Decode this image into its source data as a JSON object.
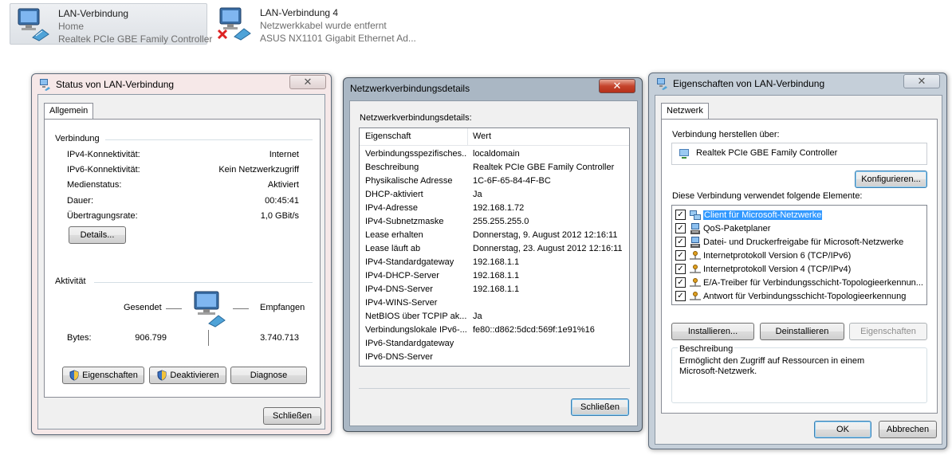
{
  "adapters": [
    {
      "name": "LAN-Verbindung",
      "status": "Home",
      "device": "Realtek PCIe GBE Family Controller",
      "selected": true
    },
    {
      "name": "LAN-Verbindung 4",
      "status": "Netzwerkkabel wurde entfernt",
      "device": "ASUS NX1101 Gigabit Ethernet Ad...",
      "selected": false
    }
  ],
  "status_window": {
    "title": "Status von LAN-Verbindung",
    "tab": "Allgemein",
    "connection_group": "Verbindung",
    "rows": [
      {
        "label": "IPv4-Konnektivität:",
        "value": "Internet"
      },
      {
        "label": "IPv6-Konnektivität:",
        "value": "Kein Netzwerkzugriff"
      },
      {
        "label": "Medienstatus:",
        "value": "Aktiviert"
      },
      {
        "label": "Dauer:",
        "value": "00:45:41"
      },
      {
        "label": "Übertragungsrate:",
        "value": "1,0 GBit/s"
      }
    ],
    "details_button": "Details...",
    "activity_group": "Aktivität",
    "sent_label": "Gesendet",
    "received_label": "Empfangen",
    "bytes_label": "Bytes:",
    "bytes_sent": "906.799",
    "bytes_received": "3.740.713",
    "properties_button": "Eigenschaften",
    "disable_button": "Deaktivieren",
    "diagnose_button": "Diagnose",
    "close_button": "Schließen"
  },
  "details_window": {
    "title": "Netzwerkverbindungsdetails",
    "heading": "Netzwerkverbindungsdetails:",
    "col_property": "Eigenschaft",
    "col_value": "Wert",
    "rows": [
      {
        "property": "Verbindungsspezifisches...",
        "value": "localdomain"
      },
      {
        "property": "Beschreibung",
        "value": "Realtek PCIe GBE Family Controller"
      },
      {
        "property": "Physikalische Adresse",
        "value": "1C-6F-65-84-4F-BC"
      },
      {
        "property": "DHCP-aktiviert",
        "value": "Ja"
      },
      {
        "property": "IPv4-Adresse",
        "value": "192.168.1.72"
      },
      {
        "property": "IPv4-Subnetzmaske",
        "value": "255.255.255.0"
      },
      {
        "property": "Lease erhalten",
        "value": "Donnerstag, 9. August 2012 12:16:11"
      },
      {
        "property": "Lease läuft ab",
        "value": "Donnerstag, 23. August 2012 12:16:11"
      },
      {
        "property": "IPv4-Standardgateway",
        "value": "192.168.1.1"
      },
      {
        "property": "IPv4-DHCP-Server",
        "value": "192.168.1.1"
      },
      {
        "property": "IPv4-DNS-Server",
        "value": "192.168.1.1"
      },
      {
        "property": "IPv4-WINS-Server",
        "value": ""
      },
      {
        "property": "NetBIOS über TCPIP ak...",
        "value": "Ja"
      },
      {
        "property": "Verbindungslokale IPv6-...",
        "value": "fe80::d862:5dcd:569f:1e91%16"
      },
      {
        "property": "IPv6-Standardgateway",
        "value": ""
      },
      {
        "property": "IPv6-DNS-Server",
        "value": ""
      }
    ],
    "close_button": "Schließen"
  },
  "props_window": {
    "title": "Eigenschaften von LAN-Verbindung",
    "tab": "Netzwerk",
    "connect_using_label": "Verbindung herstellen über:",
    "adapter_name": "Realtek PCIe GBE Family Controller",
    "configure_button": "Konfigurieren...",
    "items_label": "Diese Verbindung verwendet folgende Elemente:",
    "items": [
      {
        "label": "Client für Microsoft-Netzwerke",
        "checked": true,
        "selected": true,
        "icon": "network-client-icon"
      },
      {
        "label": "QoS-Paketplaner",
        "checked": true,
        "selected": false,
        "icon": "network-service-icon"
      },
      {
        "label": "Datei- und Druckerfreigabe für Microsoft-Netzwerke",
        "checked": true,
        "selected": false,
        "icon": "network-service-icon"
      },
      {
        "label": "Internetprotokoll Version 6 (TCP/IPv6)",
        "checked": true,
        "selected": false,
        "icon": "protocol-icon"
      },
      {
        "label": "Internetprotokoll Version 4 (TCP/IPv4)",
        "checked": true,
        "selected": false,
        "icon": "protocol-icon"
      },
      {
        "label": "E/A-Treiber für Verbindungsschicht-Topologieerkennun...",
        "checked": true,
        "selected": false,
        "icon": "protocol-icon"
      },
      {
        "label": "Antwort für Verbindungsschicht-Topologieerkennung",
        "checked": true,
        "selected": false,
        "icon": "protocol-icon"
      }
    ],
    "install_button": "Installieren...",
    "uninstall_button": "Deinstallieren",
    "properties_button": "Eigenschaften",
    "description_group": "Beschreibung",
    "description_text": "Ermöglicht den Zugriff auf Ressourcen in einem Microsoft-Netzwerk.",
    "ok_button": "OK",
    "cancel_button": "Abbrechen"
  },
  "colors": {
    "selection": "#3399ff",
    "close_red": "#c5432c",
    "window_frame_active": "#aab7c4"
  }
}
